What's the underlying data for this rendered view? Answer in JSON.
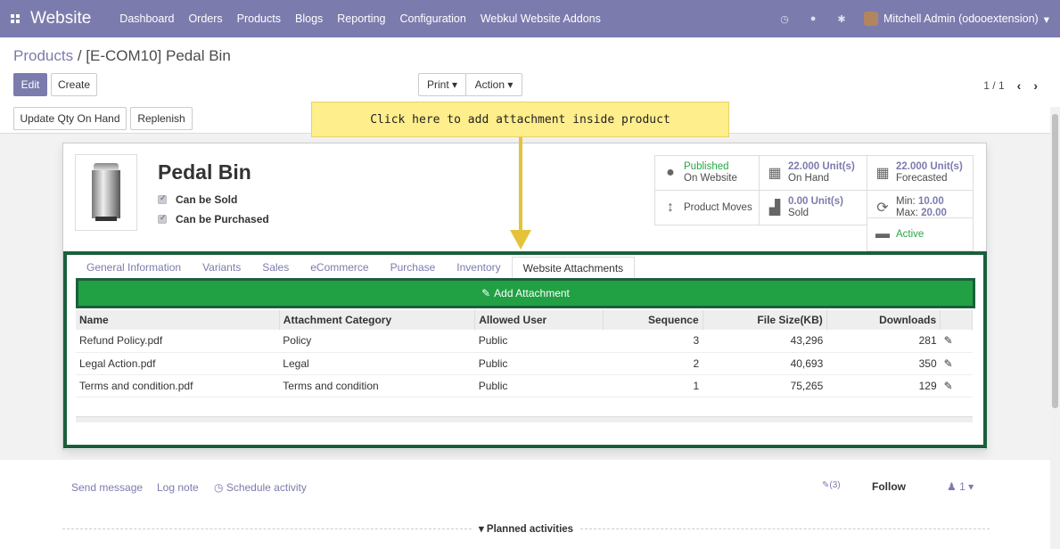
{
  "navbar": {
    "brand": "Website",
    "menu": [
      "Dashboard",
      "Orders",
      "Products",
      "Blogs",
      "Reporting",
      "Configuration",
      "Webkul Website Addons"
    ],
    "user": "Mitchell Admin (odooextension)"
  },
  "breadcrumb": {
    "parent": "Products",
    "separator": " / ",
    "current": "[E-COM10] Pedal Bin"
  },
  "buttons": {
    "edit": "Edit",
    "create": "Create",
    "print": "Print ▾",
    "action": "Action ▾",
    "update_qty": "Update Qty On Hand",
    "replenish": "Replenish"
  },
  "pager": {
    "value": "1 / 1"
  },
  "tooltip": "Click here to add attachment inside product",
  "product": {
    "name": "Pedal Bin",
    "can_be_sold": "Can be Sold",
    "can_be_purchased": "Can be Purchased"
  },
  "stats": {
    "published_1": "Published",
    "published_2": "On Website",
    "onhand_val": "22.000 Unit(s)",
    "onhand_lbl": "On Hand",
    "forecast_val": "22.000 Unit(s)",
    "forecast_lbl": "Forecasted",
    "moves": "Product Moves",
    "sold_val": "0.00 Unit(s)",
    "sold_lbl": "Sold",
    "min_lbl": "Min:",
    "min_val": "10.00",
    "max_lbl": "Max:",
    "max_val": "20.00",
    "active": "Active"
  },
  "tabs": [
    "General Information",
    "Variants",
    "Sales",
    "eCommerce",
    "Purchase",
    "Inventory",
    "Website Attachments"
  ],
  "add_attachment": "Add Attachment",
  "table": {
    "headers": [
      "Name",
      "Attachment Category",
      "Allowed User",
      "Sequence",
      "File Size(KB)",
      "Downloads"
    ],
    "rows": [
      [
        "Refund Policy.pdf",
        "Policy",
        "Public",
        "3",
        "43,296",
        "281"
      ],
      [
        "Legal Action.pdf",
        "Legal",
        "Public",
        "2",
        "40,693",
        "350"
      ],
      [
        "Terms and condition.pdf",
        "Terms and condition",
        "Public",
        "1",
        "75,265",
        "129"
      ]
    ]
  },
  "chatter": {
    "send_message": "Send message",
    "log_note": "Log note",
    "schedule": "Schedule activity",
    "attachments": "(3)",
    "follow": "Follow",
    "followers": "1",
    "planned": "Planned activities"
  }
}
